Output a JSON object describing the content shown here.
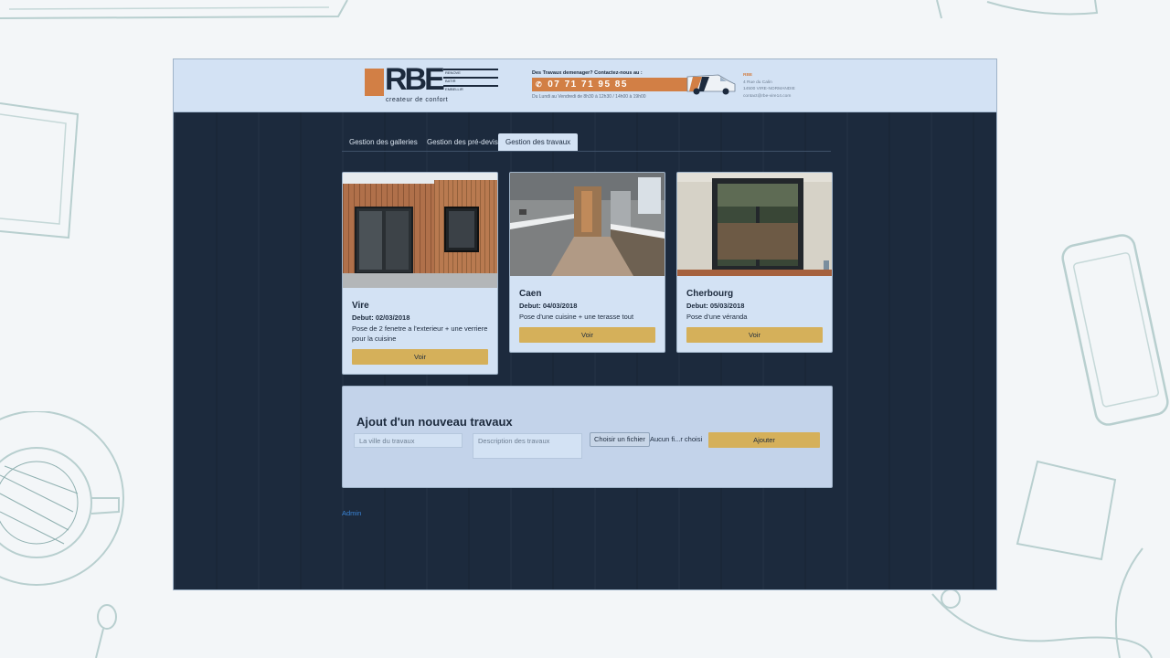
{
  "header": {
    "logo_text": "RBE",
    "logo_lines": [
      "RENOVE",
      "BATIR",
      "EMBELLIR"
    ],
    "logo_tagline": "createur de confort",
    "contact_question": "Des Travaux demenager? Contactez-nous au :",
    "phone": "07 71 71 95 85",
    "hours": "Du Lundi au Vendredi de 8h30 à 12h30 / 14h00 à 19h00",
    "address_name": "RBE",
    "address_lines": [
      "4 Rue du Calin",
      "14500 VIRE-NORMANDIE",
      "contact@rbe-vire14.com"
    ]
  },
  "tabs": [
    {
      "label": "Gestion des galleries",
      "active": false
    },
    {
      "label": "Gestion des pré-devis",
      "active": false
    },
    {
      "label": "Gestion des travaux",
      "active": true
    }
  ],
  "cards": [
    {
      "city": "Vire",
      "date": "Debut: 02/03/2018",
      "description": "Pose de 2 fenetre a l'exterieur + une verriere pour la cuisine",
      "button": "Voir"
    },
    {
      "city": "Caen",
      "date": "Debut: 04/03/2018",
      "description": "Pose d'une cuisine + une terasse tout",
      "button": "Voir"
    },
    {
      "city": "Cherbourg",
      "date": "Debut: 05/03/2018",
      "description": "Pose d'une véranda",
      "button": "Voir"
    }
  ],
  "add_form": {
    "title": "Ajout d'un nouveau travaux",
    "city_placeholder": "La ville du travaux",
    "description_placeholder": "Description des travaux",
    "file_button": "Choisir un fichier",
    "file_status": "Aucun fi...r choisi",
    "submit": "Ajouter"
  },
  "footer": {
    "admin_link": "Admin"
  },
  "colors": {
    "accent": "#d5b05a",
    "brand_orange": "#d27f45",
    "navy": "#1c2a3d",
    "panel": "#d3e2f4"
  }
}
